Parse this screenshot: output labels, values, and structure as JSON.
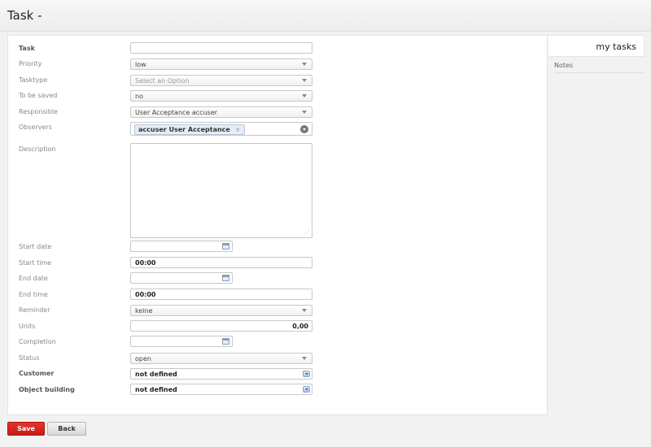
{
  "page": {
    "title": "Task -"
  },
  "side": {
    "tab_label": "my tasks",
    "notes_label": "Notes"
  },
  "form": {
    "task": {
      "label": "Task",
      "value": ""
    },
    "priority": {
      "label": "Priority",
      "value": "low"
    },
    "tasktype": {
      "label": "Tasktype",
      "placeholder": "Select an Option"
    },
    "to_be_saved": {
      "label": "To be saved",
      "value": "no"
    },
    "responsible": {
      "label": "Responsible",
      "value": "User Acceptance accuser"
    },
    "observers": {
      "label": "Observers",
      "chip": "accuser User Acceptance",
      "chip_remove": "×"
    },
    "description": {
      "label": "Description",
      "value": ""
    },
    "start_date": {
      "label": "Start date",
      "value": ""
    },
    "start_time": {
      "label": "Start time",
      "value": "00:00"
    },
    "end_date": {
      "label": "End date",
      "value": ""
    },
    "end_time": {
      "label": "End time",
      "value": "00:00"
    },
    "reminder": {
      "label": "Reminder",
      "value": "keine"
    },
    "units": {
      "label": "Units",
      "value": "0,00"
    },
    "completion": {
      "label": "Completion",
      "value": ""
    },
    "status": {
      "label": "Status",
      "value": "open"
    },
    "customer": {
      "label": "Customer",
      "value": "not defined"
    },
    "object_building": {
      "label": "Object building",
      "value": "not defined"
    }
  },
  "buttons": {
    "save": "Save",
    "back": "Back"
  }
}
